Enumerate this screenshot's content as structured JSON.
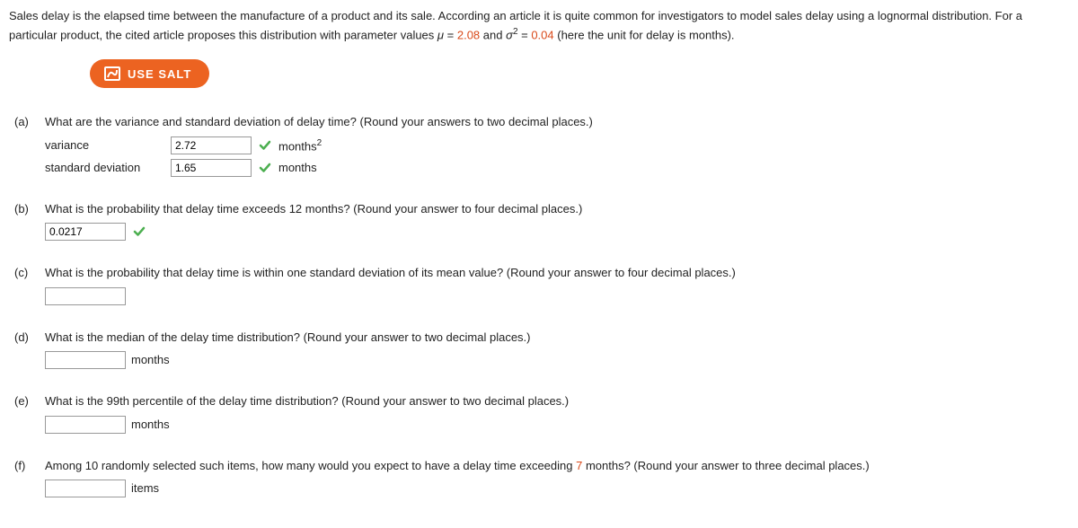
{
  "intro": {
    "part1": "Sales delay is the elapsed time between the manufacture of a product and its sale. According an article it is quite common for investigators to model sales delay using a lognormal distribution. For a particular product, the cited article proposes this distribution with parameter values ",
    "mu_sym": "μ",
    "eq1": " = ",
    "mu_val": "2.08",
    "and": " and ",
    "sigma_sym": "σ",
    "sigma_sup": "2",
    "eq2": " = ",
    "sigma_val": "0.04",
    "part2": " (here the unit for delay is months)."
  },
  "salt_btn": "USE SALT",
  "a": {
    "label": "(a)",
    "text": "What are the variance and standard deviation of delay time? (Round your answers to two decimal places.)",
    "variance_label": "variance",
    "variance_val": "2.72",
    "variance_unit": "months",
    "variance_sup": "2",
    "sd_label": "standard deviation",
    "sd_val": "1.65",
    "sd_unit": "months"
  },
  "b": {
    "label": "(b)",
    "text": "What is the probability that delay time exceeds 12 months? (Round your answer to four decimal places.)",
    "val": "0.0217"
  },
  "c": {
    "label": "(c)",
    "text": "What is the probability that delay time is within one standard deviation of its mean value? (Round your answer to four decimal places.)",
    "val": ""
  },
  "d": {
    "label": "(d)",
    "text": "What is the median of the delay time distribution? (Round your answer to two decimal places.)",
    "val": "",
    "unit": "months"
  },
  "e": {
    "label": "(e)",
    "text": "What is the 99th percentile of the delay time distribution? (Round your answer to two decimal places.)",
    "val": "",
    "unit": "months"
  },
  "f": {
    "label": "(f)",
    "text_1": "Among 10 randomly selected such items, how many would you expect to have a delay time exceeding ",
    "seven": "7",
    "text_2": " months? (Round your answer to three decimal places.)",
    "val": "",
    "unit": "items"
  }
}
